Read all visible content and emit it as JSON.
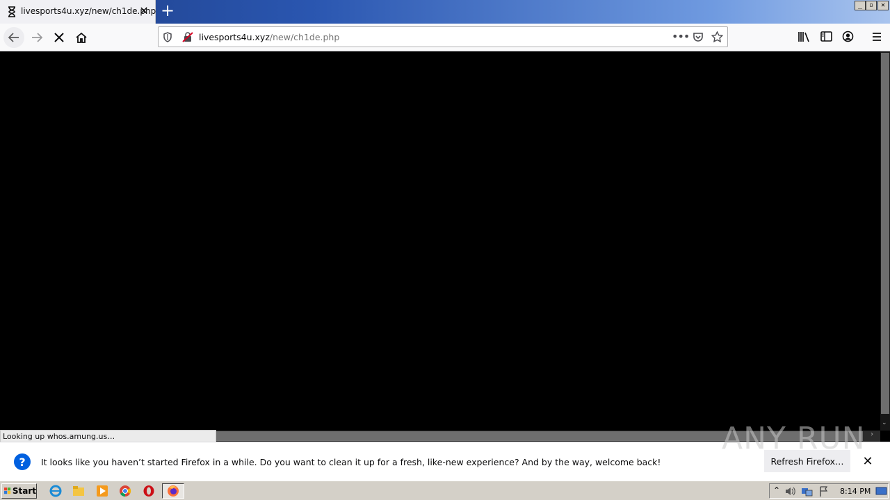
{
  "browser": {
    "tab": {
      "title": "livesports4u.xyz/new/ch1de.php",
      "icon": "hourglass-loading-icon"
    },
    "window_controls": {
      "minimize": "_",
      "restore": "▫",
      "close": "✕"
    },
    "url": {
      "host": "livesports4u.xyz",
      "path": "/new/ch1de.php"
    },
    "status_text": "Looking up whos.amung.us…"
  },
  "notification": {
    "message": "It looks like you haven’t started Firefox in a while. Do you want to clean it up for a fresh, like-new experience? And by the way, welcome back!",
    "button_label": "Refresh Firefox…"
  },
  "watermark": "ANY RUN",
  "taskbar": {
    "start_label": "Start",
    "clock": "8:14 PM",
    "pinned": [
      "internet-explorer-icon",
      "file-explorer-icon",
      "media-player-icon",
      "chrome-icon",
      "opera-icon",
      "firefox-icon"
    ]
  },
  "colors": {
    "title_gradient_start": "#1e3e86",
    "content_bg": "#000000",
    "notif_icon": "#0060df"
  }
}
